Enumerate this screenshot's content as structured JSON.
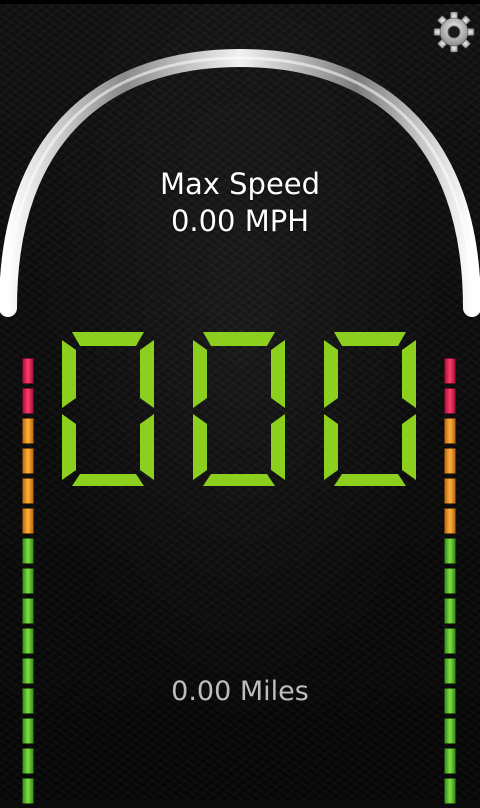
{
  "header": {
    "max_speed_label": "Max Speed",
    "max_speed_value": "0.00 MPH"
  },
  "speed_display": {
    "digits": [
      "0",
      "0",
      "0"
    ],
    "color": "#8ccf1e"
  },
  "distance": {
    "label": "0.00 Miles"
  },
  "settings": {
    "icon": "gear-icon"
  },
  "level_meter": {
    "segments": [
      "red",
      "red",
      "orange",
      "orange",
      "orange",
      "orange",
      "green",
      "green",
      "green",
      "green",
      "green",
      "green",
      "green",
      "green",
      "green"
    ],
    "colors": {
      "red": "#e0204c",
      "orange": "#ff9e2a",
      "green": "#6cd13a"
    }
  }
}
